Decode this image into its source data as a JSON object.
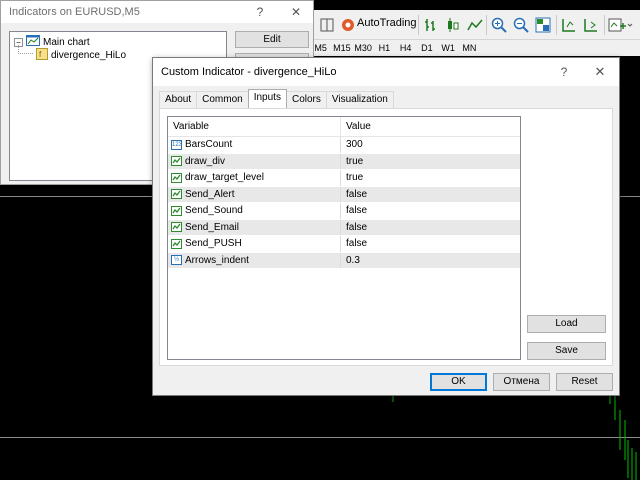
{
  "toolbar": {
    "autotrading_label": "AutoTrading",
    "timeframes": [
      "M5",
      "M15",
      "M30",
      "H1",
      "H4",
      "D1",
      "W1",
      "MN"
    ]
  },
  "indicators_window": {
    "title": "Indicators on EURUSD,M5",
    "close_glyph": "✕",
    "help_glyph": "?",
    "tree": {
      "expander": "−",
      "root_label": "Main chart",
      "child_label": "divergence_HiLo"
    },
    "edit_label": "Edit"
  },
  "dialog": {
    "title": "Custom Indicator - divergence_HiLo",
    "help_glyph": "?",
    "close_glyph": "✕",
    "tabs": [
      {
        "label": "About",
        "active": false
      },
      {
        "label": "Common",
        "active": false
      },
      {
        "label": "Inputs",
        "active": true
      },
      {
        "label": "Colors",
        "active": false
      },
      {
        "label": "Visualization",
        "active": false
      }
    ],
    "grid": {
      "headers": {
        "variable": "Variable",
        "value": "Value"
      },
      "rows": [
        {
          "variable": "BarsCount",
          "value": "300",
          "icon": "int-icon",
          "icon_text": "123"
        },
        {
          "variable": "draw_div",
          "value": "true",
          "icon": "bool-icon"
        },
        {
          "variable": "draw_target_level",
          "value": "true",
          "icon": "bool-icon"
        },
        {
          "variable": "Send_Alert",
          "value": "false",
          "icon": "bool-icon"
        },
        {
          "variable": "Send_Sound",
          "value": "false",
          "icon": "bool-icon"
        },
        {
          "variable": "Send_Email",
          "value": "false",
          "icon": "bool-icon"
        },
        {
          "variable": "Send_PUSH",
          "value": "false",
          "icon": "bool-icon"
        },
        {
          "variable": "Arrows_indent",
          "value": "0.3",
          "icon": "double-icon",
          "icon_text": "½"
        }
      ]
    },
    "load_label": "Load",
    "save_label": "Save",
    "ok_label": "OK",
    "cancel_label": "Отмена",
    "reset_label": "Reset"
  },
  "colors": {
    "accent": "#0078d7",
    "bool_icon": "#2e8b2e",
    "chart_bg": "#000000",
    "candle_green": "#00c000"
  }
}
